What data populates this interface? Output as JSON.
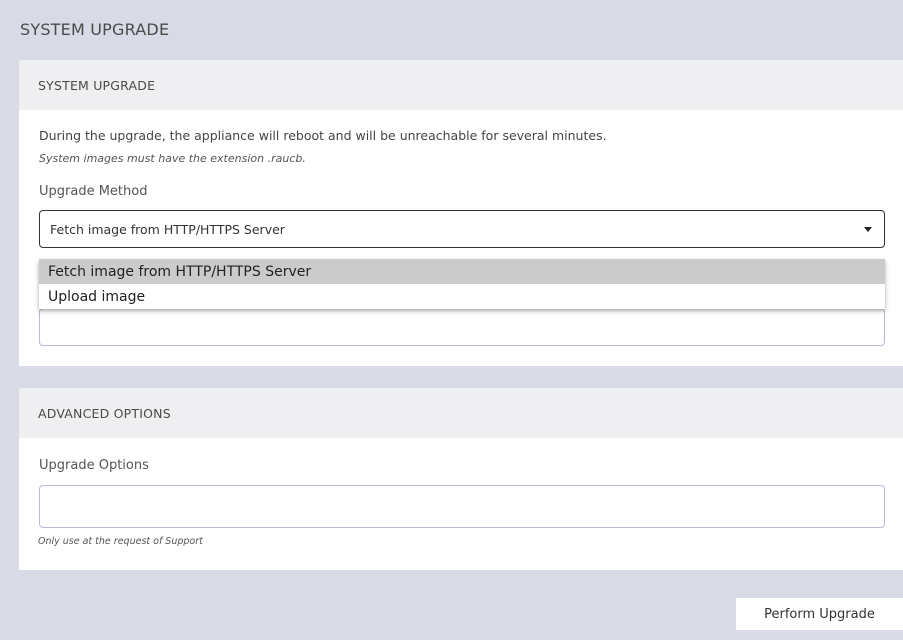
{
  "page": {
    "title": "SYSTEM UPGRADE"
  },
  "upgrade_card": {
    "header": "SYSTEM UPGRADE",
    "description": "During the upgrade, the appliance will reboot and will be unreachable for several minutes.",
    "note": "System images must have the extension .raucb.",
    "method_label": "Upgrade Method",
    "method_selected": "Fetch image from HTTP/HTTPS Server",
    "method_options": [
      "Fetch image from HTTP/HTTPS Server",
      "Upload image"
    ]
  },
  "advanced_card": {
    "header": "ADVANCED OPTIONS",
    "options_label": "Upgrade Options",
    "options_value": "",
    "options_help": "Only use at the request of Support"
  },
  "actions": {
    "perform_label": "Perform Upgrade"
  }
}
